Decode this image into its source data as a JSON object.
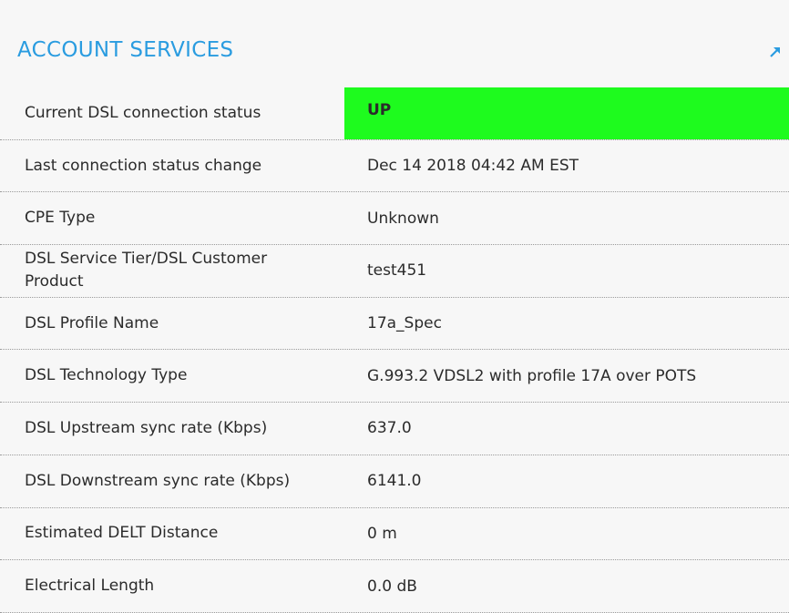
{
  "header": {
    "title": "ACCOUNT SERVICES",
    "expand_icon": "external-link-icon",
    "accent_color": "#2a9ce0"
  },
  "status_color": "#1efb1e",
  "rows": [
    {
      "label": "Current DSL connection status",
      "value": "UP"
    },
    {
      "label": "Last connection status change",
      "value": "Dec 14 2018 04:42 AM EST"
    },
    {
      "label": "CPE Type",
      "value": "Unknown"
    },
    {
      "label": "DSL Service Tier/DSL Customer Product",
      "value": "test451"
    },
    {
      "label": "DSL Profile Name",
      "value": "17a_Spec"
    },
    {
      "label": "DSL Technology Type",
      "value": "G.993.2 VDSL2 with profile 17A over POTS"
    },
    {
      "label": "DSL Upstream sync rate (Kbps)",
      "value": "637.0"
    },
    {
      "label": "DSL Downstream sync rate (Kbps)",
      "value": "6141.0"
    },
    {
      "label": "Estimated DELT Distance",
      "value": "0 m"
    },
    {
      "label": "Electrical Length",
      "value": "0.0 dB"
    }
  ]
}
